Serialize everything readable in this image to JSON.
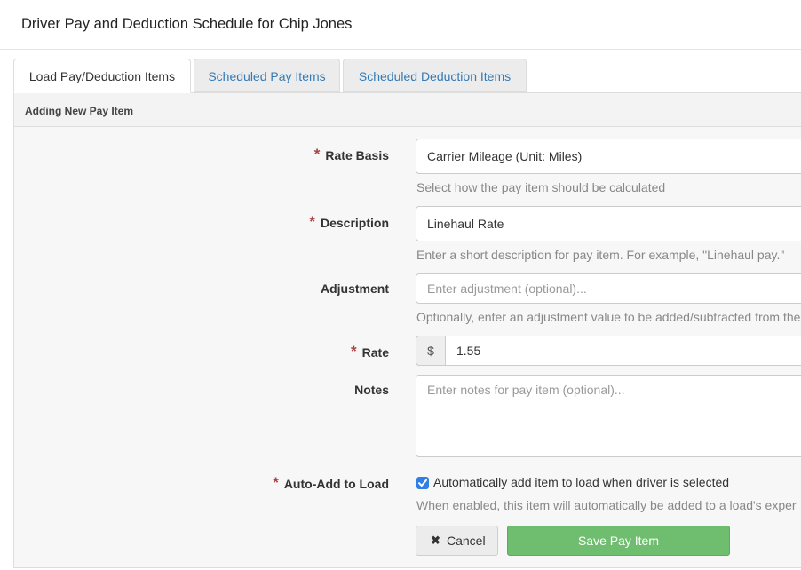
{
  "modal": {
    "title": "Driver Pay and Deduction Schedule for Chip Jones"
  },
  "tabs": [
    {
      "label": "Load Pay/Deduction Items"
    },
    {
      "label": "Scheduled Pay Items"
    },
    {
      "label": "Scheduled Deduction Items"
    }
  ],
  "panel": {
    "heading": "Adding New Pay Item"
  },
  "form": {
    "required_marker": "*",
    "rate_basis": {
      "label": "Rate Basis",
      "value": "Carrier Mileage (Unit: Miles)",
      "help": "Select how the pay item should be calculated"
    },
    "description": {
      "label": "Description",
      "value": "Linehaul Rate",
      "help": "Enter a short description for pay item. For example, \"Linehaul pay.\""
    },
    "adjustment": {
      "label": "Adjustment",
      "placeholder": "Enter adjustment (optional)...",
      "help": "Optionally, enter an adjustment value to be added/subtracted from the"
    },
    "rate": {
      "label": "Rate",
      "prefix": "$",
      "value": "1.55"
    },
    "notes": {
      "label": "Notes",
      "placeholder": "Enter notes for pay item  (optional)..."
    },
    "auto_add": {
      "label": "Auto-Add to Load",
      "checked": true,
      "checkbox_label": "Automatically add item to load when driver is selected",
      "help": "When enabled, this item will automatically be added to a load's exper"
    }
  },
  "buttons": {
    "cancel": "Cancel",
    "save": "Save Pay Item"
  },
  "colors": {
    "link": "#337ab7",
    "required": "#a94442",
    "save": "#6fbe6f",
    "checkbox": "#2f7fe6"
  }
}
